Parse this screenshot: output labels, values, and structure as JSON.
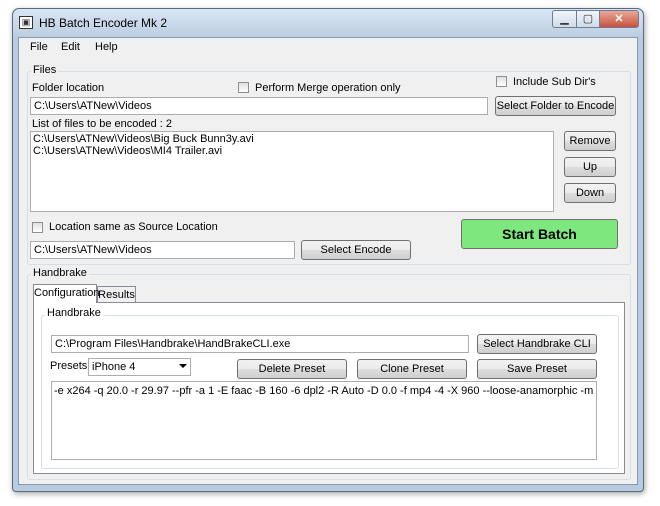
{
  "window": {
    "title": "HB Batch Encoder Mk 2"
  },
  "menu": [
    "File",
    "Edit",
    "Help"
  ],
  "files": {
    "group_label": "Files",
    "folder_location_label": "Folder location",
    "merge_label": "Perform Merge operation only",
    "include_subdirs_label": "Include Sub Dir's",
    "folder_path": "C:\\Users\\ATNew\\Videos",
    "select_folder_button": "Select Folder to Encode",
    "list_label": "List of files to be encoded : 2",
    "files": [
      "C:\\Users\\ATNew\\Videos\\Big Buck Bunn3y.avi",
      "C:\\Users\\ATNew\\Videos\\MI4 Trailer.avi"
    ],
    "remove_button": "Remove",
    "up_button": "Up",
    "down_button": "Down",
    "same_location_label": "Location same as Source Location",
    "encode_path": "C:\\Users\\ATNew\\Videos",
    "select_encode_button": "Select Encode",
    "start_batch_button": "Start Batch"
  },
  "handbrake": {
    "group_label": "Handbrake",
    "tabs": [
      "Configuration",
      "Results"
    ],
    "inner_group_label": "Handbrake",
    "cli_path": "C:\\Program Files\\Handbrake\\HandBrakeCLI.exe",
    "select_cli_button": "Select Handbrake CLI",
    "presets_label": "Presets",
    "preset_value": "iPhone 4",
    "delete_preset_button": "Delete Preset",
    "clone_preset_button": "Clone Preset",
    "save_preset_button": "Save Preset",
    "arguments": "-e x264  -q 20.0 -r 29.97 --pfr  -a 1 -E faac -B 160 -6 dpl2 -R Auto -D 0.0 -f mp4 -4 -X 960 --loose-anamorphic -m"
  },
  "colors": {
    "start_batch_bg": "#7ee87e",
    "window_frame": "#b9cbe0"
  }
}
